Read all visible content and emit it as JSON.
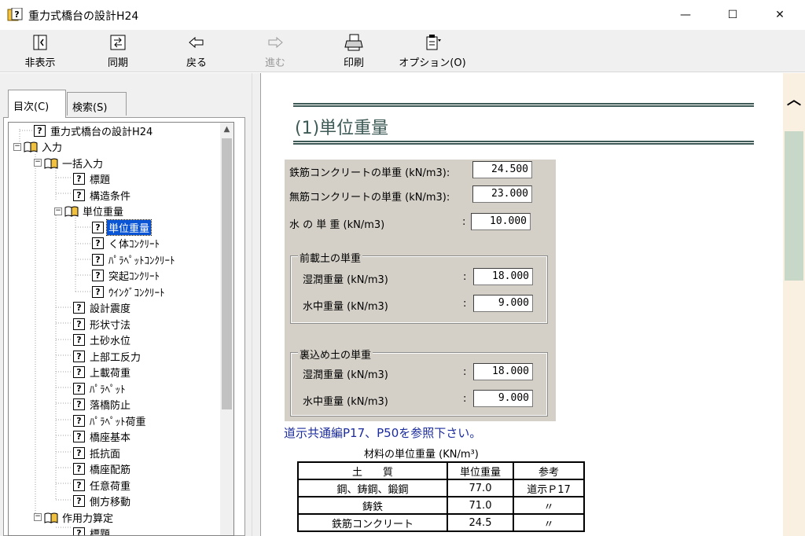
{
  "window": {
    "title": "重力式橋台の設計H24",
    "minimize_glyph": "—",
    "maximize_glyph": "☐",
    "close_glyph": "✕"
  },
  "toolbar": {
    "buttons": [
      {
        "label": "非表示",
        "icon": "hide-pane-icon",
        "enabled": true
      },
      {
        "label": "同期",
        "icon": "sync-icon",
        "enabled": true
      },
      {
        "label": "戻る",
        "icon": "back-arrow-icon",
        "enabled": true
      },
      {
        "label": "進む",
        "icon": "forward-arrow-icon",
        "enabled": false
      },
      {
        "label": "印刷",
        "icon": "printer-icon",
        "enabled": true
      },
      {
        "label": "オプション(O)",
        "icon": "options-icon",
        "enabled": true
      }
    ]
  },
  "left_pane": {
    "tabs": [
      {
        "label": "目次(C)",
        "active": true
      },
      {
        "label": "検索(S)",
        "active": false
      }
    ],
    "tree": [
      {
        "label": "重力式橋台の設計H24",
        "type": "topic",
        "level": 1
      },
      {
        "label": "入力",
        "type": "book",
        "level": 0,
        "expanded": true
      },
      {
        "label": "一括入力",
        "type": "book",
        "level": 1,
        "expanded": true
      },
      {
        "label": "標題",
        "type": "topic",
        "level": 2
      },
      {
        "label": "構造条件",
        "type": "topic",
        "level": 2
      },
      {
        "label": "単位重量",
        "type": "book",
        "level": 1.5,
        "expanded": true
      },
      {
        "label": "単位重量",
        "type": "topic",
        "level": 3,
        "selected": true
      },
      {
        "label": "く体ｺﾝｸﾘｰﾄ",
        "type": "topic",
        "level": 3
      },
      {
        "label": "ﾊﾟﾗﾍﾟｯﾄｺﾝｸﾘｰﾄ",
        "type": "topic",
        "level": 3
      },
      {
        "label": "突起ｺﾝｸﾘｰﾄ",
        "type": "topic",
        "level": 3
      },
      {
        "label": "ｳｲﾝｸﾞｺﾝｸﾘｰﾄ",
        "type": "topic",
        "level": 3
      },
      {
        "label": "設計震度",
        "type": "topic",
        "level": 2
      },
      {
        "label": "形状寸法",
        "type": "topic",
        "level": 2
      },
      {
        "label": "土砂水位",
        "type": "topic",
        "level": 2
      },
      {
        "label": "上部工反力",
        "type": "topic",
        "level": 2
      },
      {
        "label": "上載荷重",
        "type": "topic",
        "level": 2
      },
      {
        "label": "ﾊﾟﾗﾍﾟｯﾄ",
        "type": "topic",
        "level": 2
      },
      {
        "label": "落橋防止",
        "type": "topic",
        "level": 2
      },
      {
        "label": "ﾊﾟﾗﾍﾟｯﾄ荷重",
        "type": "topic",
        "level": 2
      },
      {
        "label": "橋座基本",
        "type": "topic",
        "level": 2
      },
      {
        "label": "抵抗面",
        "type": "topic",
        "level": 2
      },
      {
        "label": "橋座配筋",
        "type": "topic",
        "level": 2
      },
      {
        "label": "任意荷重",
        "type": "topic",
        "level": 2
      },
      {
        "label": "側方移動",
        "type": "topic",
        "level": 2
      },
      {
        "label": "作用力算定",
        "type": "book",
        "level": 1,
        "expanded": true
      },
      {
        "label": "標題",
        "type": "topic",
        "level": 2
      }
    ]
  },
  "content": {
    "section_title": "(1)単位重量",
    "fields": [
      {
        "label": "鉄筋コンクリートの単重 (kN/m3):",
        "value": "24.500"
      },
      {
        "label": "無筋コンクリートの単重 (kN/m3):",
        "value": "23.000"
      },
      {
        "label": "水 の 単 重 (kN/m3)",
        "colon": ":",
        "value": "10.000"
      }
    ],
    "groups": [
      {
        "title": "前載土の単重",
        "fields": [
          {
            "label": "湿潤重量 (kN/m3)",
            "colon": ":",
            "value": "18.000"
          },
          {
            "label": "水中重量 (kN/m3)",
            "colon": ":",
            "value": "9.000"
          }
        ]
      },
      {
        "title": "裏込め土の単重",
        "fields": [
          {
            "label": "湿潤重量 (kN/m3)",
            "colon": ":",
            "value": "18.000"
          },
          {
            "label": "水中重量 (kN/m3)",
            "colon": ":",
            "value": "9.000"
          }
        ]
      }
    ],
    "reference_link": "道示共通編P17、P50を参照下さい。",
    "table_caption": "材料の単位重量 (KN/m³)",
    "table": {
      "headers": [
        "土　　質",
        "単位重量",
        "参考"
      ],
      "rows": [
        [
          "鋼、鋳鋼、鍛鋼",
          "77.0",
          "道示Ｐ17"
        ],
        [
          "鋳鉄",
          "71.0",
          "〃"
        ],
        [
          "鉄筋コンクリート",
          "24.5",
          "〃"
        ]
      ]
    }
  },
  "colors": {
    "title_teal": "#3d5a56",
    "form_bg": "#d4d0c8",
    "selection": "#0a54d6",
    "link": "#1c2c9e",
    "scrollbar_track": "#faf0e1"
  }
}
